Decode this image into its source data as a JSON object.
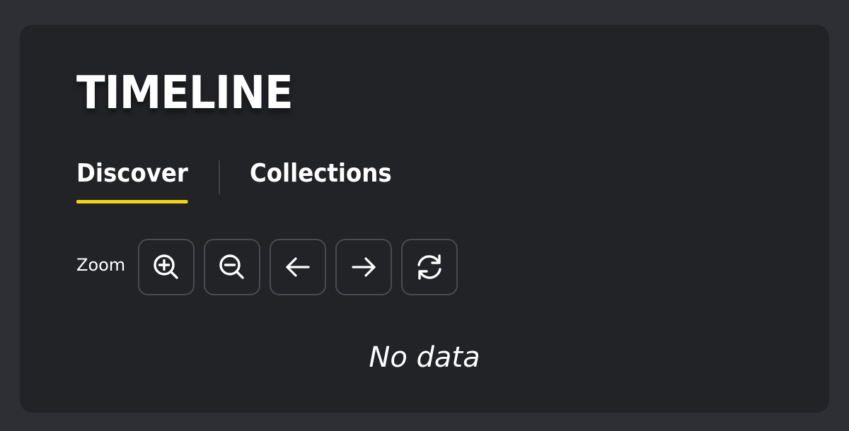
{
  "panel": {
    "title": "TIMELINE"
  },
  "tabs": [
    {
      "label": "Discover",
      "active": true
    },
    {
      "label": "Collections",
      "active": false
    }
  ],
  "accent_color": "#f5d31b",
  "zoom": {
    "label": "Zoom",
    "buttons": [
      {
        "icon": "zoom-in-icon"
      },
      {
        "icon": "zoom-out-icon"
      },
      {
        "icon": "arrow-left-icon"
      },
      {
        "icon": "arrow-right-icon"
      },
      {
        "icon": "refresh-icon"
      }
    ]
  },
  "empty_state": {
    "message": "No data"
  }
}
